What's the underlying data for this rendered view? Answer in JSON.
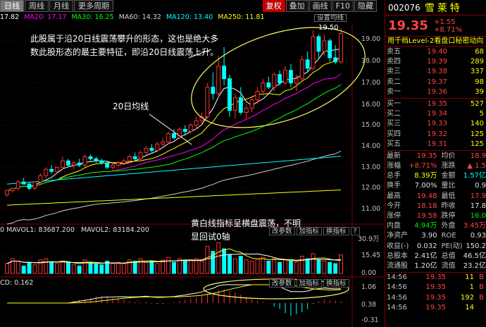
{
  "toolbar": {
    "tabs": [
      "日线",
      "周线",
      "月线",
      "更多周期"
    ],
    "tools": [
      "复权",
      "叠加",
      "画线",
      "F10",
      "隐藏"
    ]
  },
  "ma": {
    "items": [
      {
        "label": "17.82",
        "color": "#ffffff"
      },
      {
        "label": "MA20: 17.17",
        "color": "#ff00ff"
      },
      {
        "label": "MA30: 16.25",
        "color": "#00ff00"
      },
      {
        "label": "MA60: 14.32",
        "color": "#d0d0d0"
      },
      {
        "label": "MA120: 13.40",
        "color": "#00ffff"
      },
      {
        "label": "MA250: 11.81",
        "color": "#ffff00"
      }
    ],
    "settings_button": "设置均线"
  },
  "annotations": {
    "main_text_line1": "此股属于沿20日线震荡攀升的形态，这也是绝大多",
    "main_text_line2": "数此股形态的最主要特征，即沿20日线震荡上升。",
    "ma20_label": "20日均线",
    "peak_label": "19.50",
    "volume_text_line1": "黄白线指标呈横盘震荡，不明",
    "volume_text_line2": "显回试0轴"
  },
  "price_axis": [
    "19.00",
    "18.00",
    "17.00",
    "16.00",
    "15.00",
    "14.00",
    "13.00",
    "12.00",
    "11.00"
  ],
  "volume": {
    "labels": [
      "0",
      "MAVOL1: 83687.200",
      "MAVOL2: 83184.200"
    ],
    "axis": [
      "30.9万",
      "15.45",
      "0.00"
    ],
    "buttons": [
      "改参数",
      "加指标",
      "换指标",
      "?"
    ]
  },
  "macd": {
    "label": "CD: 0.162",
    "axis": [
      "1.06",
      "0.38",
      "-0.31"
    ],
    "buttons": [
      "改参数",
      "加指标",
      "换指标"
    ]
  },
  "chart_data": [
    {
      "type": "candlestick",
      "title": "",
      "ylim": [
        10.5,
        19.8
      ],
      "candles": [
        [
          11.7,
          11.9,
          11.6,
          11.9
        ],
        [
          11.9,
          12.0,
          11.8,
          12.0
        ],
        [
          12.0,
          12.4,
          11.9,
          12.3
        ],
        [
          12.3,
          12.5,
          12.2,
          12.2
        ],
        [
          12.2,
          12.3,
          11.9,
          12.0
        ],
        [
          12.0,
          12.3,
          11.9,
          12.3
        ],
        [
          12.3,
          12.7,
          12.2,
          12.6
        ],
        [
          12.6,
          13.0,
          12.5,
          12.9
        ],
        [
          12.9,
          13.1,
          12.7,
          12.8
        ],
        [
          12.8,
          13.0,
          12.7,
          13.0
        ],
        [
          13.0,
          13.5,
          12.9,
          13.3
        ],
        [
          13.3,
          13.4,
          13.0,
          13.1
        ],
        [
          13.1,
          13.3,
          12.9,
          13.2
        ],
        [
          13.2,
          13.4,
          13.0,
          13.1
        ],
        [
          13.1,
          13.6,
          13.0,
          13.5
        ],
        [
          13.5,
          13.6,
          13.3,
          13.4
        ],
        [
          13.4,
          13.5,
          13.2,
          13.3
        ],
        [
          13.3,
          13.4,
          13.1,
          13.2
        ],
        [
          13.2,
          13.3,
          12.9,
          13.0
        ],
        [
          13.0,
          13.2,
          12.8,
          13.1
        ],
        [
          13.1,
          13.3,
          13.0,
          13.2
        ],
        [
          13.2,
          13.4,
          13.1,
          13.3
        ],
        [
          13.3,
          13.6,
          13.2,
          13.5
        ],
        [
          13.5,
          13.7,
          13.3,
          13.4
        ],
        [
          13.4,
          13.8,
          13.3,
          13.7
        ],
        [
          13.7,
          14.0,
          13.6,
          13.9
        ],
        [
          13.9,
          14.1,
          13.7,
          13.8
        ],
        [
          13.8,
          14.2,
          13.7,
          14.1
        ],
        [
          14.1,
          14.4,
          14.0,
          14.2
        ],
        [
          14.2,
          14.7,
          14.1,
          14.6
        ],
        [
          14.6,
          14.8,
          14.3,
          14.4
        ],
        [
          14.4,
          14.9,
          14.3,
          14.8
        ],
        [
          14.8,
          15.0,
          14.5,
          14.7
        ],
        [
          14.7,
          15.1,
          14.6,
          15.0
        ],
        [
          15.0,
          15.4,
          14.8,
          15.2
        ],
        [
          15.2,
          15.6,
          15.0,
          15.4
        ],
        [
          15.4,
          17.0,
          15.3,
          16.8
        ],
        [
          16.8,
          17.5,
          16.2,
          16.5
        ],
        [
          16.5,
          18.3,
          16.3,
          17.8
        ],
        [
          17.8,
          18.7,
          16.9,
          17.2
        ],
        [
          17.2,
          17.4,
          15.4,
          15.7
        ],
        [
          15.7,
          16.5,
          15.3,
          16.3
        ],
        [
          16.3,
          16.8,
          15.5,
          15.6
        ],
        [
          15.6,
          16.0,
          15.3,
          15.8
        ],
        [
          15.8,
          16.4,
          15.6,
          16.2
        ],
        [
          16.2,
          16.8,
          16.0,
          16.6
        ],
        [
          16.6,
          17.2,
          16.4,
          17.0
        ],
        [
          17.0,
          17.3,
          16.7,
          16.8
        ],
        [
          16.8,
          17.5,
          16.6,
          17.4
        ],
        [
          17.4,
          17.6,
          16.9,
          17.0
        ],
        [
          17.0,
          17.8,
          16.9,
          17.6
        ],
        [
          17.6,
          17.9,
          16.8,
          17.0
        ],
        [
          17.0,
          17.4,
          16.6,
          17.2
        ],
        [
          17.2,
          18.3,
          17.1,
          18.1
        ],
        [
          18.1,
          18.5,
          17.5,
          17.7
        ],
        [
          17.7,
          19.5,
          17.6,
          19.2
        ],
        [
          19.2,
          19.3,
          18.2,
          18.5
        ],
        [
          18.5,
          19.3,
          18.3,
          19.0
        ],
        [
          19.0,
          19.1,
          18.0,
          18.2
        ],
        [
          18.2,
          18.8,
          17.9,
          18.0
        ],
        [
          18.0,
          19.6,
          17.9,
          19.35
        ]
      ]
    },
    {
      "type": "bar",
      "title": "",
      "ylim": [
        0,
        30.9
      ],
      "values": [
        8,
        12,
        10,
        6,
        9,
        7,
        11,
        12,
        9,
        8,
        10,
        9,
        7,
        6,
        11,
        9,
        8,
        7,
        10,
        8,
        9,
        8,
        11,
        10,
        12,
        9,
        10,
        8,
        11,
        13,
        9,
        12,
        10,
        11,
        12,
        10,
        22,
        18,
        25,
        20,
        15,
        12,
        14,
        11,
        10,
        12,
        13,
        10,
        12,
        9,
        11,
        10,
        9,
        14,
        12,
        16,
        11,
        10,
        9,
        8,
        15
      ],
      "up": [
        1,
        1,
        1,
        0,
        0,
        1,
        1,
        1,
        0,
        1,
        1,
        0,
        1,
        0,
        1,
        0,
        0,
        0,
        0,
        1,
        1,
        1,
        1,
        0,
        1,
        1,
        0,
        1,
        1,
        1,
        0,
        1,
        0,
        1,
        1,
        1,
        1,
        0,
        1,
        0,
        0,
        1,
        0,
        1,
        1,
        1,
        1,
        0,
        1,
        0,
        1,
        0,
        1,
        1,
        0,
        1,
        0,
        1,
        0,
        0,
        1
      ]
    }
  ],
  "panel": {
    "code": "002076",
    "name": "雪莱特",
    "price": "19.35",
    "change": "+1.55",
    "change_pct": "+8.71%",
    "link_text": "用千档Level-2看盘口秘密动向",
    "asks": [
      {
        "label": "卖五",
        "price": "19.40",
        "vol": "68"
      },
      {
        "label": "卖四",
        "price": "19.39",
        "vol": "289"
      },
      {
        "label": "卖三",
        "price": "19.38",
        "vol": "337"
      },
      {
        "label": "卖二",
        "price": "19.37",
        "vol": "98"
      },
      {
        "label": "卖一",
        "price": "19.36",
        "vol": "39"
      }
    ],
    "bids": [
      {
        "label": "买一",
        "price": "19.35",
        "vol": "527"
      },
      {
        "label": "买二",
        "price": "19.34",
        "vol": "5"
      },
      {
        "label": "买三",
        "price": "19.33",
        "vol": "140"
      },
      {
        "label": "买四",
        "price": "19.32",
        "vol": "125"
      },
      {
        "label": "买五",
        "price": "19.31",
        "vol": "125"
      }
    ],
    "stats": [
      {
        "k": "最新",
        "v": "19.35",
        "vc": "red",
        "k2": "均价",
        "v2": "18.9",
        "v2c": "red"
      },
      {
        "k": "涨幅",
        "v": "+8.71%",
        "vc": "red",
        "k2": "涨跌",
        "v2": "▲ 1.5",
        "v2c": "red"
      },
      {
        "k": "总手",
        "v": "8.39万",
        "vc": "yel",
        "k2": "金额",
        "v2": "1.57亿",
        "v2c": "cyan"
      },
      {
        "k": "换手",
        "v": "7.00%",
        "vc": "wht",
        "k2": "量比",
        "v2": "0.9",
        "v2c": "wht"
      },
      {
        "k": "最高",
        "v": "19.48",
        "vc": "red",
        "k2": "最低",
        "v2": "17.9",
        "v2c": "red"
      },
      {
        "k": "今开",
        "v": "18.18",
        "vc": "red",
        "k2": "昨收",
        "v2": "17.8",
        "v2c": "wht"
      },
      {
        "k": "涨停",
        "v": "19.58",
        "vc": "red",
        "k2": "跌停",
        "v2": "16.0",
        "v2c": "green"
      },
      {
        "k": "内盘",
        "v": "4.94万",
        "vc": "green",
        "k2": "外盘",
        "v2": "3.45万",
        "v2c": "red"
      },
      {
        "k": "净资产",
        "v": "3.90",
        "vc": "wht",
        "k2": "ROE",
        "v2": "0.93",
        "v2c": "wht"
      },
      {
        "k": "收益(-)",
        "v": "0.032",
        "vc": "wht",
        "k2": "PE(动)",
        "v2": "150.2",
        "v2c": "wht"
      },
      {
        "k": "总股本",
        "v": "2.41亿",
        "vc": "wht",
        "k2": "总值",
        "v2": "46.5亿",
        "v2c": "wht"
      },
      {
        "k": "流通股",
        "v": "1.20亿",
        "vc": "wht",
        "k2": "流值",
        "v2": "23.2亿",
        "v2c": "wht"
      }
    ],
    "ticks": [
      {
        "t": "14:56",
        "p": "19.35",
        "q": "11",
        "s": "B"
      },
      {
        "t": "14:56",
        "p": "19.35",
        "q": "1",
        "s": "B"
      },
      {
        "t": "14:56",
        "p": "19.35",
        "q": "192",
        "s": "B"
      },
      {
        "t": "14:56",
        "p": "19.35",
        "q": "14",
        "s": ""
      }
    ]
  }
}
